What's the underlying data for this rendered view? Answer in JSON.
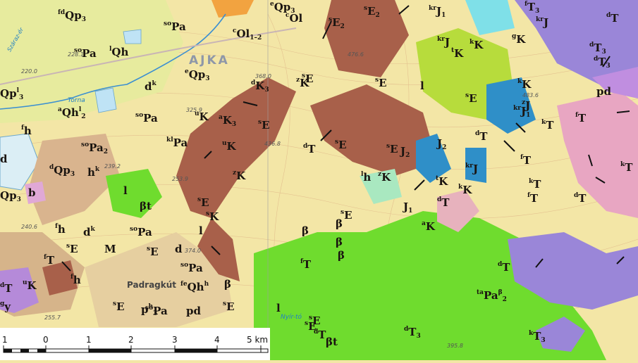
{
  "town_name": "AJKA",
  "town_name_2": "Padragkút",
  "water_labels": [
    "Torna",
    "Nyír-tó",
    "Száraz-ér"
  ],
  "heights": [
    "220.0",
    "239.2",
    "253.9",
    "325.9",
    "368.0",
    "436.8",
    "476.6",
    "483.6",
    "240.6",
    "255.7",
    "374.0",
    "395.8",
    "228.1"
  ],
  "scale": {
    "ticks": [
      "1",
      "0",
      "1",
      "2",
      "3",
      "4",
      "5 km"
    ]
  },
  "colors": {
    "background": "#f3e6a6",
    "brown": "#a8604a",
    "green": "#6fdc2e",
    "purple": "#9a86d8",
    "pink": "#e8a6c2",
    "blue": "#2f8fc8",
    "tan": "#d6b48a",
    "cyan": "#7fe0e8"
  },
  "labels": [
    {
      "t": "Qp",
      "sub": "3",
      "sup": "",
      "pre": "fd"
    },
    {
      "t": "Qp",
      "sub": "3",
      "sup": "",
      "pre": "e"
    },
    {
      "t": "Ol",
      "sub": "",
      "sup": "",
      "pre": "c"
    },
    {
      "t": "Ol",
      "sub": "1–2",
      "sup": "",
      "pre": "c"
    },
    {
      "t": "E",
      "sub": "2",
      "sup": "",
      "pre": "s"
    },
    {
      "t": "E",
      "sub": "2",
      "sup": "",
      "pre": "s"
    },
    {
      "t": "J",
      "sub": "1",
      "sup": "",
      "pre": "kr"
    },
    {
      "t": "T",
      "sub": "3",
      "sup": "",
      "pre": "f"
    },
    {
      "t": "T",
      "sub": "",
      "sup": "",
      "pre": "d"
    },
    {
      "t": "Pa",
      "sub": "",
      "sup": "",
      "pre": "so"
    },
    {
      "t": "Pa",
      "sub": "",
      "sup": "",
      "pre": "so"
    },
    {
      "t": "Qh",
      "sub": "",
      "sup": "",
      "pre": "l"
    },
    {
      "t": "Qp",
      "sub": "3",
      "sup": "l",
      "pre": ""
    },
    {
      "t": "Qp",
      "sub": "3",
      "sup": "",
      "pre": "e"
    },
    {
      "t": "K",
      "sub": "3",
      "sup": "",
      "pre": "d"
    },
    {
      "t": "E",
      "sub": "",
      "sup": "",
      "pre": "s"
    },
    {
      "t": "d",
      "sub": "",
      "sup": "k",
      "pre": ""
    },
    {
      "t": "Qh",
      "sub": "2",
      "sup": "l",
      "pre": "a"
    },
    {
      "t": "Pa",
      "sub": "",
      "sup": "",
      "pre": "so"
    },
    {
      "t": "h",
      "sub": "",
      "sup": "",
      "pre": "f"
    },
    {
      "t": "Pa",
      "sub": "2",
      "sup": "",
      "pre": "so"
    },
    {
      "t": "Qp",
      "sub": "3",
      "sup": "",
      "pre": "d"
    },
    {
      "t": "h",
      "sub": "",
      "sup": "k",
      "pre": ""
    },
    {
      "t": "Pa",
      "sub": "",
      "sup": "",
      "pre": "kl"
    },
    {
      "t": "K",
      "sub": "",
      "sup": "",
      "pre": "u"
    },
    {
      "t": "K",
      "sub": "3",
      "sup": "",
      "pre": "a"
    },
    {
      "t": "E",
      "sub": "",
      "sup": "",
      "pre": "s"
    },
    {
      "t": "K",
      "sub": "",
      "sup": "",
      "pre": "u"
    },
    {
      "t": "E",
      "sub": "",
      "sup": "",
      "pre": "s"
    },
    {
      "t": "J",
      "sub": "2",
      "sup": "",
      "pre": ""
    },
    {
      "t": "K",
      "sub": "",
      "sup": "",
      "pre": "z"
    },
    {
      "t": "d",
      "sub": "",
      "sup": "",
      "pre": ""
    },
    {
      "t": "b",
      "sub": "",
      "sup": "",
      "pre": ""
    },
    {
      "t": "Qp",
      "sub": "3",
      "sup": "",
      "pre": ""
    },
    {
      "t": "l",
      "sub": "",
      "sup": "",
      "pre": ""
    },
    {
      "t": "βt",
      "sub": "",
      "sup": "",
      "pre": ""
    },
    {
      "t": "Pa",
      "sub": "",
      "sup": "",
      "pre": "so"
    },
    {
      "t": "h",
      "sub": "",
      "sup": "",
      "pre": "f"
    },
    {
      "t": "d",
      "sub": "",
      "sup": "k",
      "pre": ""
    },
    {
      "t": "E",
      "sub": "",
      "sup": "",
      "pre": "s"
    },
    {
      "t": "Pa",
      "sub": "",
      "sup": "",
      "pre": "so"
    },
    {
      "t": "T",
      "sub": "",
      "sup": "",
      "pre": "f"
    },
    {
      "t": "K",
      "sub": "",
      "sup": "",
      "pre": "u"
    },
    {
      "t": "E",
      "sub": "",
      "sup": "",
      "pre": "s"
    },
    {
      "t": "E",
      "sub": "",
      "sup": "",
      "pre": "s"
    },
    {
      "t": "Qh",
      "sub": "",
      "sup": "h",
      "pre": "fe"
    },
    {
      "t": "β",
      "sub": "",
      "sup": "",
      "pre": ""
    },
    {
      "t": "pd",
      "sub": "",
      "sup": "",
      "pre": ""
    },
    {
      "t": "Pa",
      "sub": "",
      "sup": "",
      "pre": "so"
    },
    {
      "t": "E",
      "sub": "",
      "sup": "",
      "pre": "s"
    },
    {
      "t": "l",
      "sub": "",
      "sup": "",
      "pre": ""
    },
    {
      "t": "E",
      "sub": "",
      "sup": "",
      "pre": "s"
    },
    {
      "t": "T",
      "sub": "",
      "sup": "",
      "pre": "d"
    },
    {
      "t": "βt",
      "sub": "",
      "sup": "",
      "pre": ""
    },
    {
      "t": "T",
      "sub": "3",
      "sup": "",
      "pre": "d"
    },
    {
      "t": "Pa",
      "sub": "2",
      "sup": "β",
      "pre": "ta"
    },
    {
      "t": "T",
      "sub": "3",
      "sup": "",
      "pre": "k"
    },
    {
      "t": "T",
      "sub": "",
      "sup": "",
      "pre": "f"
    },
    {
      "t": "β",
      "sub": "",
      "sup": "",
      "pre": ""
    },
    {
      "t": "β",
      "sub": "",
      "sup": "",
      "pre": ""
    },
    {
      "t": "β",
      "sub": "",
      "sup": "",
      "pre": ""
    },
    {
      "t": "E",
      "sub": "",
      "sup": "",
      "pre": "s"
    },
    {
      "t": "h",
      "sub": "",
      "sup": "",
      "pre": "l"
    },
    {
      "t": "K",
      "sub": "",
      "sup": "",
      "pre": "z"
    },
    {
      "t": "K",
      "sub": "",
      "sup": "",
      "pre": "a"
    },
    {
      "t": "J",
      "sub": "1",
      "sup": "",
      "pre": ""
    },
    {
      "t": "K",
      "sub": "",
      "sup": "",
      "pre": "t"
    },
    {
      "t": "J",
      "sub": "2",
      "sup": "",
      "pre": ""
    },
    {
      "t": "J",
      "sub": "",
      "sup": "",
      "pre": "kr"
    },
    {
      "t": "J",
      "sub": "",
      "sup": "",
      "pre": "kr"
    },
    {
      "t": "J",
      "sub": "",
      "sup": "",
      "pre": "kr"
    },
    {
      "t": "T",
      "sub": "",
      "sup": "",
      "pre": "d"
    },
    {
      "t": "T",
      "sub": "",
      "sup": "",
      "pre": "d"
    },
    {
      "t": "T",
      "sub": "",
      "sup": "",
      "pre": "f"
    },
    {
      "t": "T",
      "sub": "",
      "sup": "",
      "pre": "k"
    },
    {
      "t": "T",
      "sub": "",
      "sup": "",
      "pre": "f"
    },
    {
      "t": "T",
      "sub": "",
      "sup": "",
      "pre": "k"
    },
    {
      "t": "T",
      "sub": "",
      "sup": "",
      "pre": "f"
    },
    {
      "t": "pd",
      "sub": "",
      "sup": "",
      "pre": ""
    },
    {
      "t": "T",
      "sub": "3",
      "sup": "",
      "pre": "d"
    },
    {
      "t": "T",
      "sub": "3",
      "sup": "",
      "pre": "d"
    },
    {
      "t": "T",
      "sub": "",
      "sup": "",
      "pre": "d"
    },
    {
      "t": "T",
      "sub": "",
      "sup": "",
      "pre": "k"
    },
    {
      "t": "l",
      "sub": "",
      "sup": "",
      "pre": ""
    },
    {
      "t": "K",
      "sub": "",
      "sup": "",
      "pre": "k"
    },
    {
      "t": "K",
      "sub": "",
      "sup": "",
      "pre": "z"
    },
    {
      "t": "E",
      "sub": "",
      "sup": "",
      "pre": "s"
    },
    {
      "t": "T",
      "sub": "",
      "sup": "",
      "pre": "d"
    },
    {
      "t": "E",
      "sub": "",
      "sup": "",
      "pre": "s"
    },
    {
      "t": "E",
      "sub": "",
      "sup": "",
      "pre": "s"
    },
    {
      "t": "K",
      "sub": "",
      "sup": "",
      "pre": "t"
    },
    {
      "t": "K",
      "sub": "",
      "sup": "",
      "pre": "g"
    },
    {
      "t": "K",
      "sub": "",
      "sup": "",
      "pre": "k"
    },
    {
      "t": "J",
      "sub": "",
      "sup": "",
      "pre": "z"
    },
    {
      "t": "J",
      "sub": "1",
      "sup": "",
      "pre": "kr"
    },
    {
      "t": "K",
      "sub": "",
      "sup": "",
      "pre": "k"
    },
    {
      "t": "T",
      "sub": "",
      "sup": "",
      "pre": "d"
    },
    {
      "t": "T",
      "sub": "",
      "sup": "",
      "pre": "d"
    },
    {
      "t": "y",
      "sub": "",
      "sup": "",
      "pre": "g"
    },
    {
      "t": "E",
      "sub": "",
      "sup": "",
      "pre": "s"
    },
    {
      "t": "M",
      "sub": "",
      "sup": "",
      "pre": ""
    },
    {
      "t": "p",
      "sub": "3",
      "sup": "h",
      "pre": ""
    },
    {
      "t": "d",
      "sub": "",
      "sup": "",
      "pre": ""
    },
    {
      "t": "β",
      "sub": "",
      "sup": "",
      "pre": ""
    },
    {
      "t": "l",
      "sub": "",
      "sup": "",
      "pre": ""
    },
    {
      "t": "E",
      "sub": "",
      "sup": "",
      "pre": "s"
    },
    {
      "t": "h",
      "sub": "",
      "sup": "",
      "pre": "f"
    },
    {
      "t": "K",
      "sub": "",
      "sup": "",
      "pre": "s"
    },
    {
      "t": "l",
      "sub": "",
      "sup": "",
      "pre": ""
    }
  ]
}
